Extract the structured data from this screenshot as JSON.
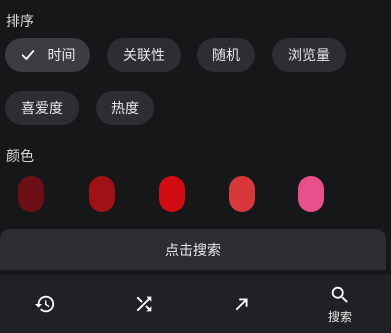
{
  "sort": {
    "label": "排序",
    "options": [
      {
        "label": "时间",
        "selected": true
      },
      {
        "label": "关联性",
        "selected": false
      },
      {
        "label": "随机",
        "selected": false
      },
      {
        "label": "浏览量",
        "selected": false
      },
      {
        "label": "喜爱度",
        "selected": false
      },
      {
        "label": "热度",
        "selected": false
      }
    ]
  },
  "color": {
    "label": "颜色",
    "swatches": [
      "#6d0f14",
      "#a10f17",
      "#d00b12",
      "#d8383a",
      "#e7508a"
    ]
  },
  "search_button": {
    "label": "点击搜索"
  },
  "bottom_nav": {
    "items": [
      {
        "icon": "history-icon",
        "label": ""
      },
      {
        "icon": "shuffle-icon",
        "label": ""
      },
      {
        "icon": "trending-arrow-icon",
        "label": ""
      },
      {
        "icon": "search-icon",
        "label": "搜索"
      }
    ]
  }
}
